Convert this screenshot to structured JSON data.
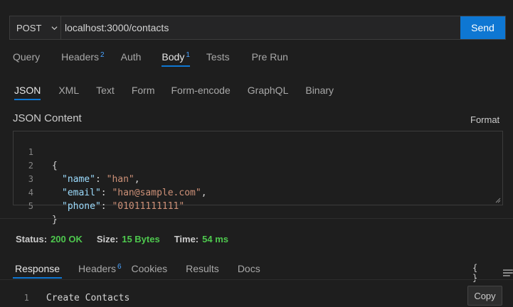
{
  "request": {
    "method": "POST",
    "url": "localhost:3000/contacts",
    "send_label": "Send"
  },
  "request_tabs": [
    {
      "label": "Query",
      "badge": ""
    },
    {
      "label": "Headers",
      "badge": "2"
    },
    {
      "label": "Auth",
      "badge": ""
    },
    {
      "label": "Body",
      "badge": "1",
      "active": true
    },
    {
      "label": "Tests",
      "badge": ""
    },
    {
      "label": "Pre Run",
      "badge": ""
    }
  ],
  "body_tabs": [
    {
      "label": "JSON",
      "active": true
    },
    {
      "label": "XML"
    },
    {
      "label": "Text"
    },
    {
      "label": "Form"
    },
    {
      "label": "Form-encode"
    },
    {
      "label": "GraphQL"
    },
    {
      "label": "Binary"
    }
  ],
  "editor": {
    "title": "JSON Content",
    "format_label": "Format",
    "lines": [
      {
        "n": "1",
        "text": "{"
      },
      {
        "n": "2",
        "key": "\"name\"",
        "value": "\"han\"",
        "trail": ","
      },
      {
        "n": "3",
        "key": "\"email\"",
        "value": "\"han@sample.com\"",
        "trail": ","
      },
      {
        "n": "4",
        "key": "\"phone\"",
        "value": "\"01011111111\"",
        "trail": ""
      },
      {
        "n": "5",
        "text": "}"
      }
    ]
  },
  "status": {
    "status_label": "Status:",
    "status_value": "200 OK",
    "size_label": "Size:",
    "size_value": "15 Bytes",
    "time_label": "Time:",
    "time_value": "54 ms"
  },
  "response_tabs": [
    {
      "label": "Response",
      "badge": "",
      "active": true
    },
    {
      "label": "Headers",
      "badge": "6"
    },
    {
      "label": "Cookies",
      "badge": ""
    },
    {
      "label": "Results",
      "badge": ""
    },
    {
      "label": "Docs",
      "badge": ""
    }
  ],
  "response": {
    "braces_label": "{ }",
    "line_number": "1",
    "text": "Create Contacts",
    "copy_label": "Copy"
  },
  "colors": {
    "accent": "#0e77d3",
    "success": "#4ec84e",
    "json_key": "#9cdcfe",
    "json_string": "#ce9178"
  }
}
